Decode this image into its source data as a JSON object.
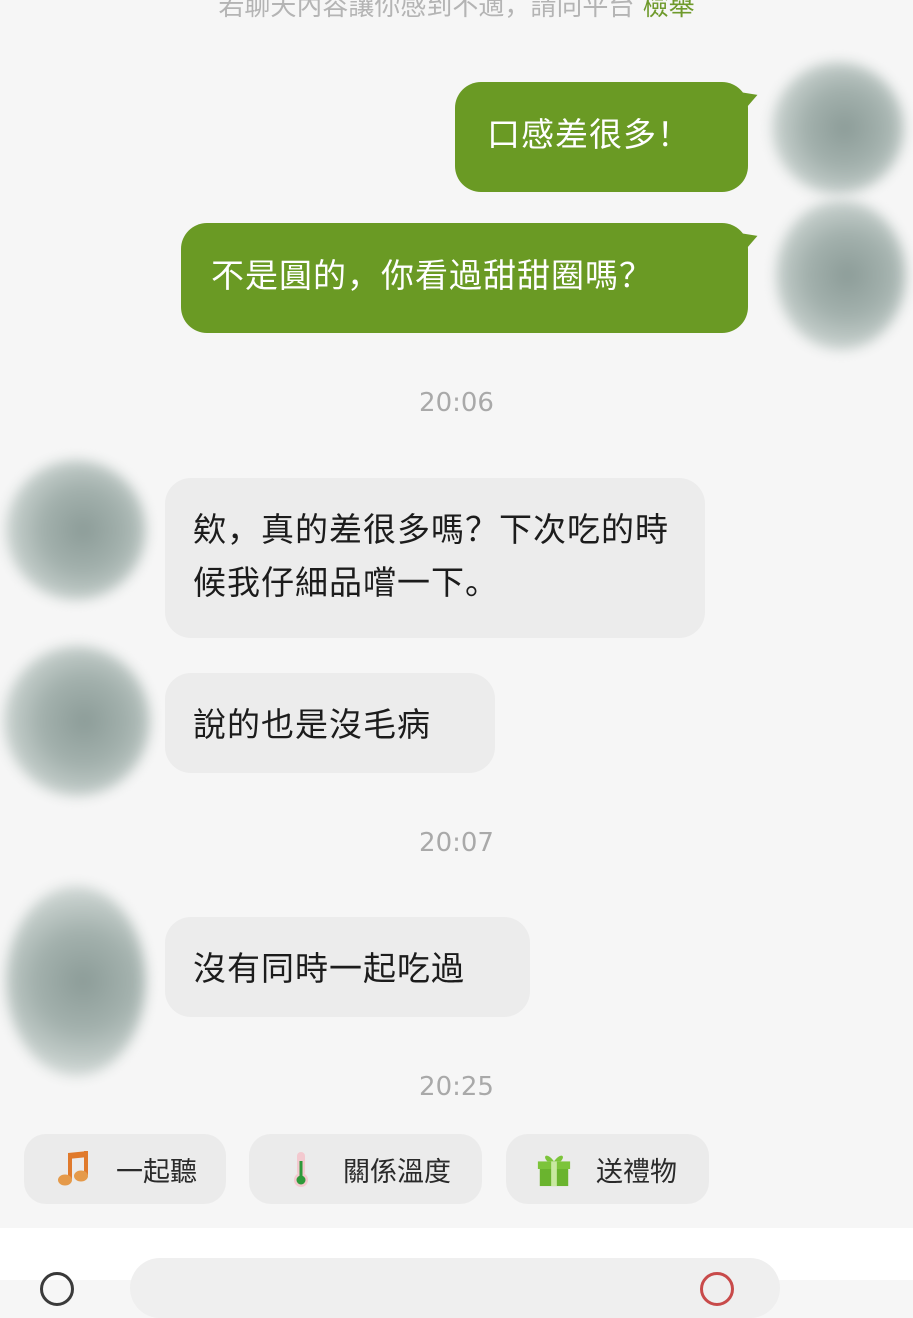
{
  "notice": {
    "text": "若聊天內容讓你感到不適，請向平台",
    "link": "檢舉"
  },
  "messages": [
    {
      "side": "out",
      "text": "口感差很多！"
    },
    {
      "side": "out",
      "text": "不是圓的，你看過甜甜圈嗎？"
    },
    {
      "side": "in",
      "text": "欸，真的差很多嗎？下次吃的時候我仔細品嚐一下。"
    },
    {
      "side": "in",
      "text": "說的也是沒毛病"
    },
    {
      "side": "in",
      "text": "沒有同時一起吃過"
    }
  ],
  "timestamps": [
    "20:06",
    "20:07",
    "20:25"
  ],
  "quick_actions": [
    {
      "label": "一起聽",
      "icon": "music-note-icon"
    },
    {
      "label": "關係溫度",
      "icon": "thermometer-icon"
    },
    {
      "label": "送禮物",
      "icon": "gift-icon"
    }
  ],
  "colors": {
    "outgoing_bubble": "#6a9a24",
    "incoming_bubble": "#ececec",
    "accent": "#6f9a2c"
  }
}
